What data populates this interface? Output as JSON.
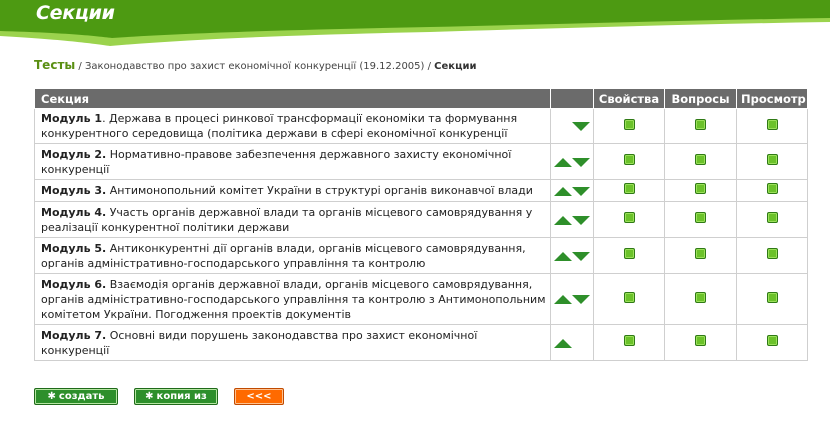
{
  "header": {
    "title": "Секции"
  },
  "breadcrumb": {
    "root": "Тесты",
    "separator": " / ",
    "middle": "Законодавство про захист економічної конкуренції (19.12.2005)",
    "current": "Секции"
  },
  "table": {
    "columns": {
      "section": "Секция",
      "properties": "Свойства",
      "questions": "Вопросы",
      "preview": "Просмотр"
    },
    "rows": [
      {
        "module": "Модуль 1",
        "sep": ".",
        "text": " Держава в процесі ринкової трансформації економіки та формування конкурентного середовища (політика держави в сфері економічної конкуренції",
        "up": false,
        "down": true
      },
      {
        "module": "Модуль 2.",
        "sep": "",
        "text": " Нормативно-правове забезпечення державного захисту економічної конкуренції",
        "up": true,
        "down": true
      },
      {
        "module": "Модуль 3.",
        "sep": "",
        "text": " Антимонопольний комітет України в структурі органів виконавчої влади",
        "up": true,
        "down": true
      },
      {
        "module": "Модуль 4.",
        "sep": "",
        "text": " Участь органів державної влади та органів місцевого самоврядування у реалізації конкурентної політики держави",
        "up": true,
        "down": true
      },
      {
        "module": "Модуль 5.",
        "sep": "",
        "text": " Антиконкурентні дії органів влади, органів місцевого самоврядування, органів адміністративно-господарського управління та контролю",
        "up": true,
        "down": true
      },
      {
        "module": "Модуль 6.",
        "sep": "",
        "text": " Взаємодія органів державної влади, органів місцевого самоврядування, органів адміністративно-господарського управління та контролю з Антимонопольним комітетом України. Погодження проектів документів",
        "up": true,
        "down": true
      },
      {
        "module": "Модуль 7.",
        "sep": "",
        "text": " Основні види порушень законодавства про захист економічної конкуренції",
        "up": true,
        "down": false
      }
    ]
  },
  "buttons": {
    "create": {
      "icon": "✱",
      "label": "создать"
    },
    "copy": {
      "icon": "✱",
      "label": "копия из"
    },
    "back": {
      "label": "<<<"
    }
  },
  "colors": {
    "header_green": "#4d9a12",
    "accent_green": "#2d8f2b",
    "dot_green": "#6bc22a",
    "back_orange": "#ff6a00",
    "table_header_gray": "#6b6b6b"
  }
}
